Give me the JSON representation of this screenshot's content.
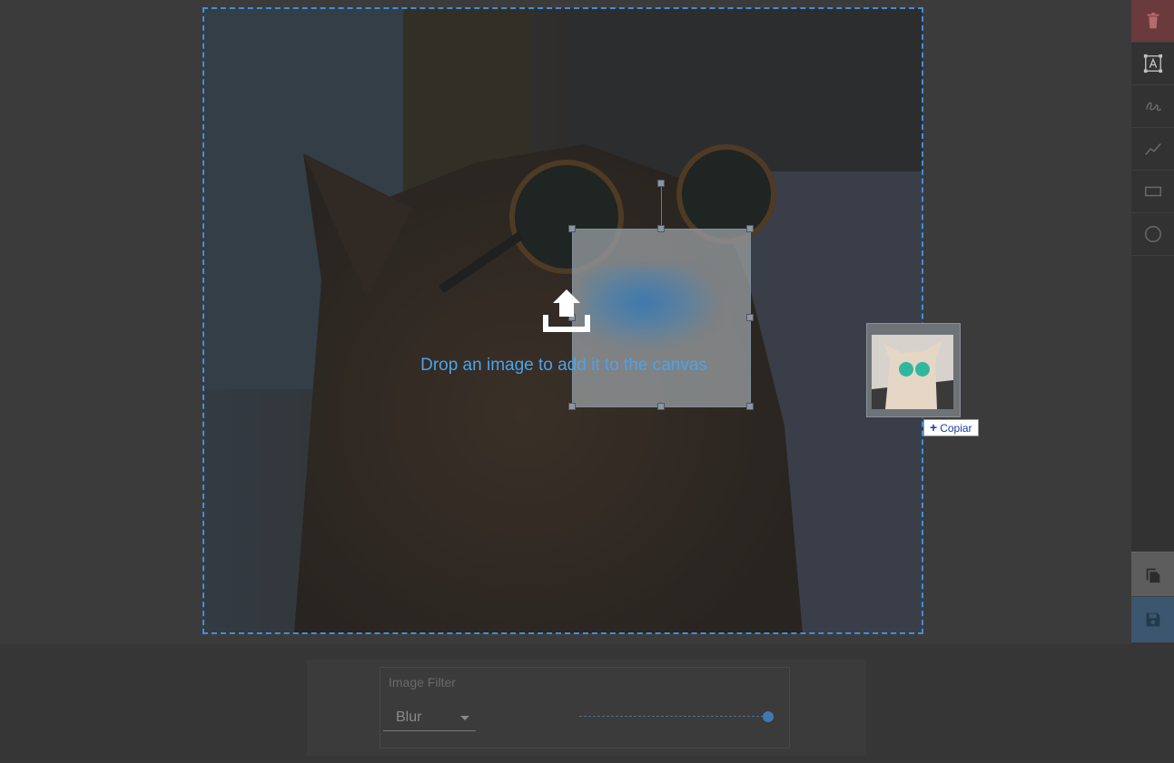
{
  "canvas": {
    "drop_message": "Drop an image to add it to the canvas"
  },
  "drag_preview": {
    "label": "Copiar"
  },
  "toolbar": {
    "items": [
      {
        "name": "delete",
        "icon": "trash-icon"
      },
      {
        "name": "text",
        "icon": "text-box-icon"
      },
      {
        "name": "draw",
        "icon": "freehand-icon"
      },
      {
        "name": "line",
        "icon": "polyline-icon"
      },
      {
        "name": "rectangle",
        "icon": "rectangle-icon"
      },
      {
        "name": "circle",
        "icon": "circle-icon"
      },
      {
        "name": "copy",
        "icon": "copy-icon"
      },
      {
        "name": "save",
        "icon": "save-icon"
      }
    ]
  },
  "filter_panel": {
    "title": "Image Filter",
    "filter": {
      "selected": "Blur"
    },
    "intensity": 1.0
  },
  "colors": {
    "accent": "#3d8fe0",
    "delete": "#6b3a3c",
    "save": "#3b566e"
  }
}
